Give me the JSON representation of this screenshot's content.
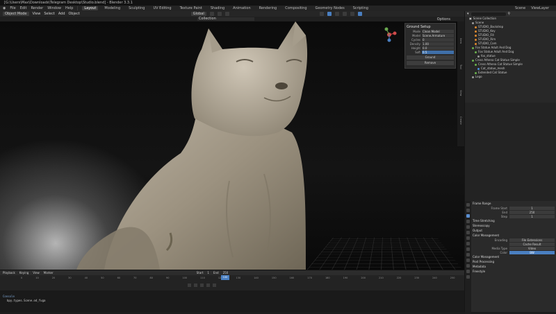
{
  "window": {
    "title": "[G:\\Users\\Max\\Downloads\\Telegram Desktop\\Studio.blend] - Blender 3.3.1"
  },
  "menu": {
    "items": [
      "File",
      "Edit",
      "Render",
      "Window",
      "Help"
    ],
    "tabs": [
      "Layout",
      "Modeling",
      "Sculpting",
      "UV Editing",
      "Texture Paint",
      "Shading",
      "Animation",
      "Rendering",
      "Compositing",
      "Geometry Nodes",
      "Scripting"
    ],
    "active_tab": "Layout",
    "scene_label": "Scene",
    "view_layer_label": "ViewLayer"
  },
  "viewport_header": {
    "mode": "Object Mode",
    "items": [
      "View",
      "Select",
      "Add",
      "Object"
    ],
    "transform": "Global",
    "options_label": "Options"
  },
  "viewport_sub": {
    "field": "Collection"
  },
  "side_strip": [
    "Item",
    "Tool",
    "View",
    "Create"
  ],
  "lego_panel": {
    "title": "Ground Setup",
    "rows": [
      {
        "label": "Mode",
        "value": "Clean Model",
        "style": "normal"
      },
      {
        "label": "Model",
        "value": "Scene.Armature",
        "style": "normal"
      },
      {
        "label": "Cycles",
        "value": "0",
        "style": "normal"
      },
      {
        "label": "Density",
        "value": "1.00",
        "style": "normal"
      },
      {
        "label": "Height",
        "value": "0.0",
        "style": "normal"
      },
      {
        "label": "Soft",
        "value": "0.5",
        "style": "blue"
      }
    ],
    "buttons": [
      "Ground",
      "Remove"
    ]
  },
  "outliner": {
    "title": "Scene Collection",
    "items": [
      {
        "label": "Scene",
        "level": 0,
        "color": "grey"
      },
      {
        "label": "STUDIO_Backdrop",
        "level": 1,
        "color": "orange"
      },
      {
        "label": "STUDIO_Key",
        "level": 1,
        "color": "orange"
      },
      {
        "label": "STUDIO_Fill",
        "level": 1,
        "color": "orange"
      },
      {
        "label": "STUDIO_Rim",
        "level": 1,
        "color": "orange"
      },
      {
        "label": "STUDIO_Cam",
        "level": 1,
        "color": "orange"
      },
      {
        "label": "Fox Statue Adult And Dog",
        "level": 0,
        "color": "green"
      },
      {
        "label": "Fox Statue Adult And Dog",
        "level": 1,
        "color": "green"
      },
      {
        "label": "fox_statue",
        "level": 2,
        "color": "grey"
      },
      {
        "label": "Cross Athena Cat Statue Simple",
        "level": 0,
        "color": "green"
      },
      {
        "label": "Cross Athena Cat Statue Simple",
        "level": 1,
        "color": "green"
      },
      {
        "label": "Cat_statue_mesh",
        "level": 2,
        "color": "blue"
      },
      {
        "label": "Extended Cat Statue",
        "level": 1,
        "color": "green"
      },
      {
        "label": "Lego",
        "level": 0,
        "color": "grey"
      }
    ]
  },
  "properties": {
    "sections": [
      {
        "title": "Frame Range",
        "rows": [
          {
            "label": "Frame Start",
            "value": "1",
            "style": "normal"
          },
          {
            "label": "End",
            "value": "250",
            "style": "normal"
          },
          {
            "label": "Step",
            "value": "1",
            "style": "normal"
          }
        ]
      },
      {
        "title": "Time Stretching",
        "rows": []
      },
      {
        "title": "Stereoscopy",
        "rows": []
      },
      {
        "title": "Output",
        "rows": []
      },
      {
        "title": "Color Management",
        "rows": [
          {
            "label": "Encoding",
            "value": "File Extensions",
            "style": "normal"
          },
          {
            "label": "",
            "value": "Cache Result",
            "style": "normal"
          },
          {
            "label": "Media Type",
            "value": "Video",
            "style": "normal"
          },
          {
            "label": "Color",
            "value": "BW",
            "style": "blue"
          }
        ]
      },
      {
        "title": "Color Management",
        "rows": []
      },
      {
        "title": "Post Processing",
        "rows": []
      },
      {
        "title": "Metadata",
        "rows": []
      },
      {
        "title": "Freestyle",
        "rows": []
      }
    ]
  },
  "timeline": {
    "header_items": [
      "Playback",
      "Keying",
      "View",
      "Marker"
    ],
    "ticks": [
      "0",
      "10",
      "20",
      "30",
      "40",
      "50",
      "60",
      "70",
      "80",
      "90",
      "100",
      "110",
      "120",
      "130",
      "140",
      "150",
      "160",
      "170",
      "180",
      "190",
      "200",
      "210",
      "220",
      "230",
      "240",
      "250"
    ],
    "current_frame": "100",
    "start_label": "Start",
    "start": "1",
    "end_label": "End",
    "end": "250"
  },
  "console": {
    "line1": "Console",
    "line2": "bpy.types.Scene.od_fuga"
  }
}
